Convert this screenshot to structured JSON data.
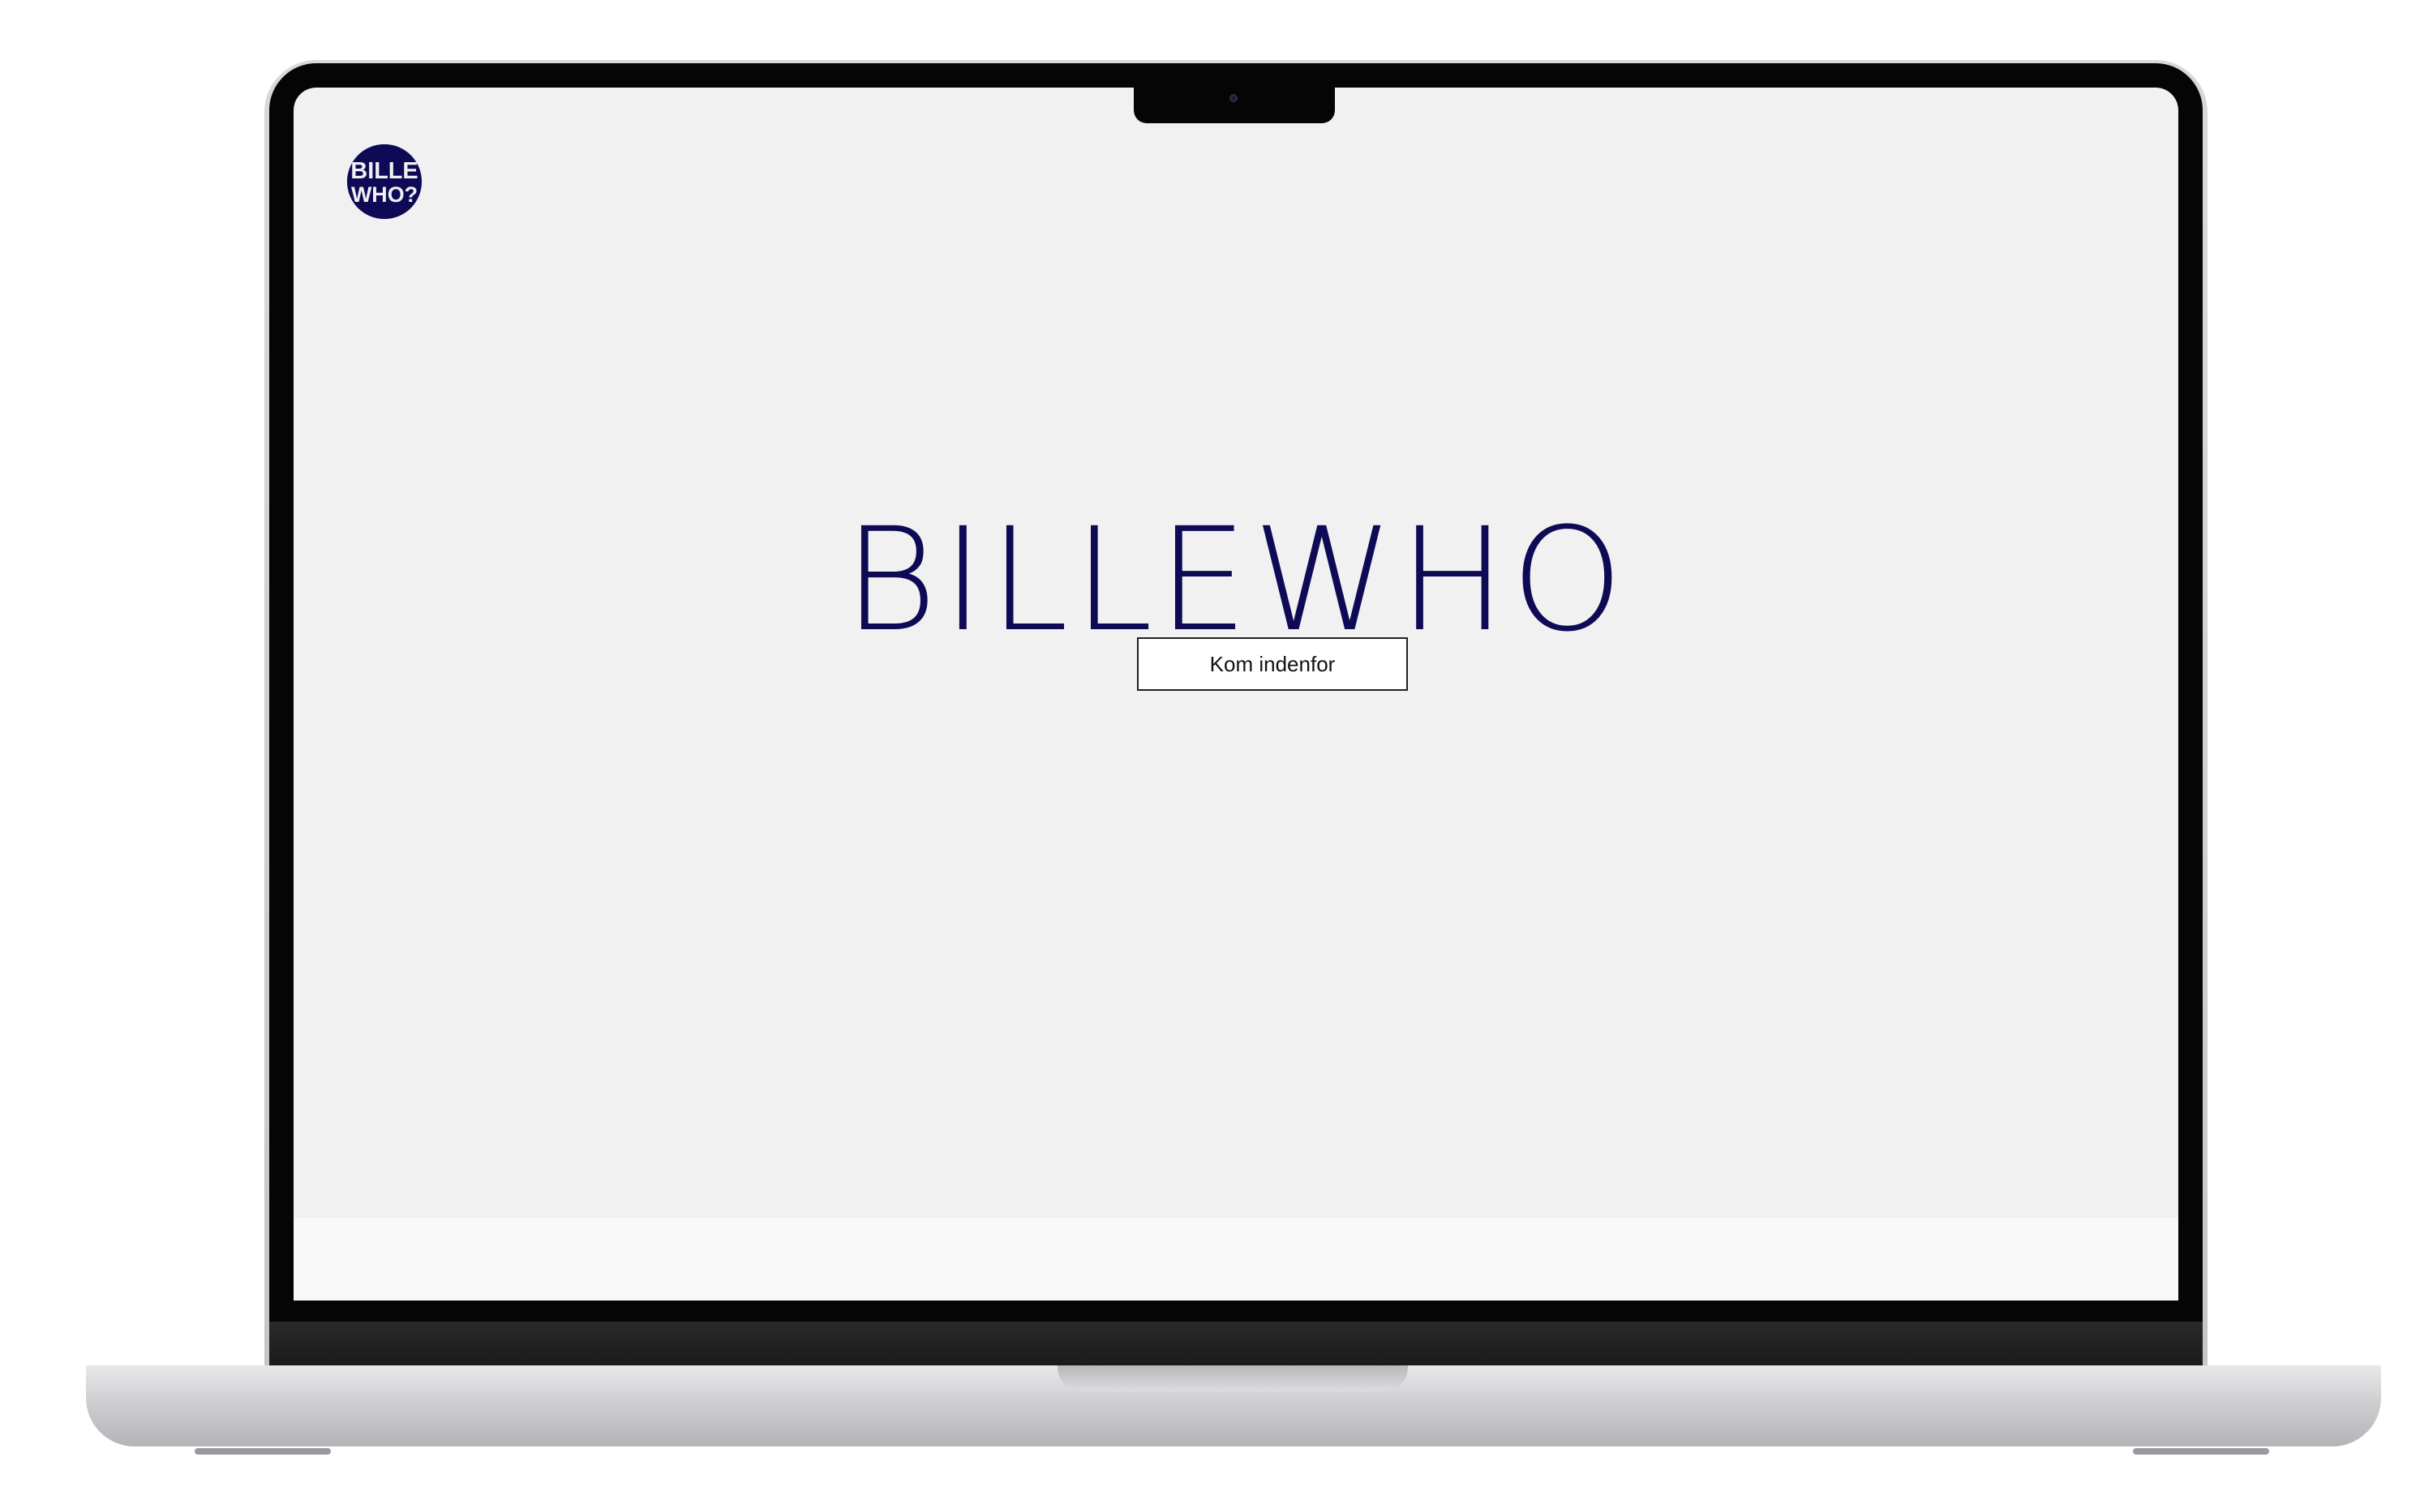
{
  "brand": {
    "logo_line1": "BILLE",
    "logo_line2": "WHO?",
    "title": "BILLEWHO"
  },
  "hero": {
    "cta_label": "Kom indenfor"
  },
  "colors": {
    "brand": "#0f0a55",
    "screen_bg": "#f1f1f1",
    "button_bg": "#ffffff"
  },
  "icons": {
    "camera": "webcam-icon"
  }
}
